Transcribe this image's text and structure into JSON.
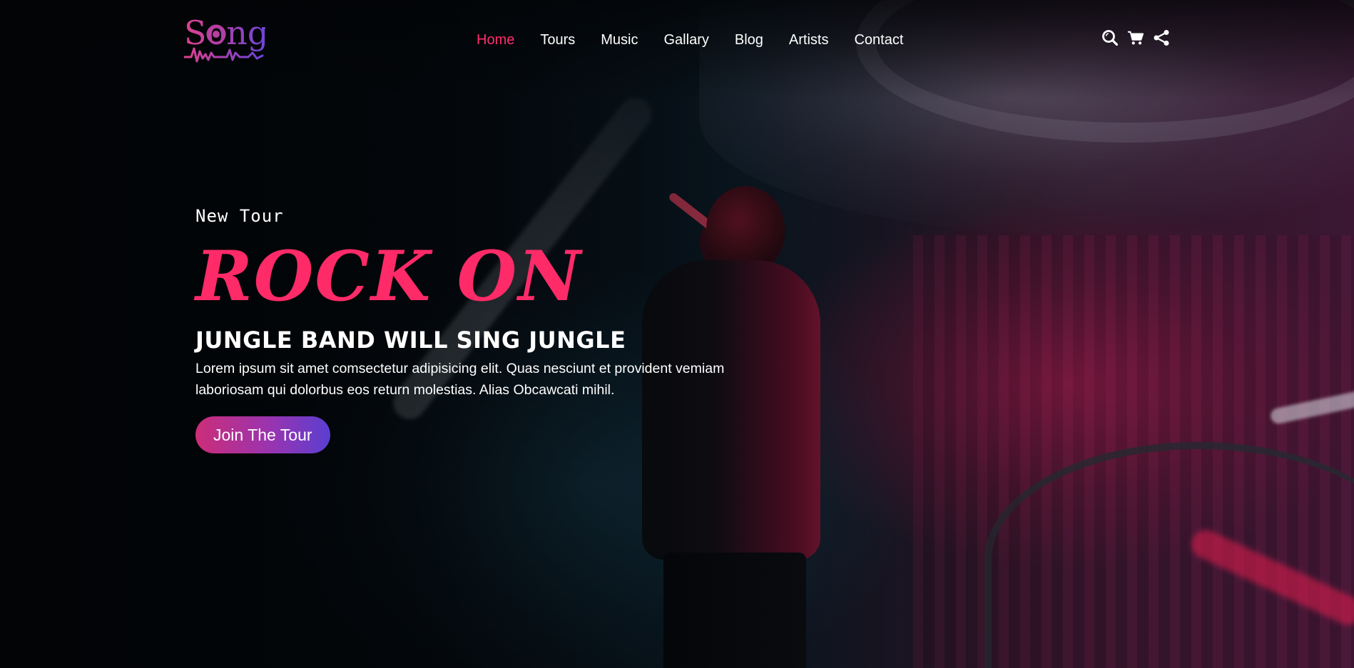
{
  "header": {
    "logo_text": "Song",
    "nav": [
      {
        "label": "Home",
        "active": true
      },
      {
        "label": "Tours",
        "active": false
      },
      {
        "label": "Music",
        "active": false
      },
      {
        "label": "Gallary",
        "active": false
      },
      {
        "label": "Blog",
        "active": false
      },
      {
        "label": "Artists",
        "active": false
      },
      {
        "label": "Contact",
        "active": false
      }
    ],
    "icons": [
      "search-icon",
      "cart-icon",
      "share-icon"
    ]
  },
  "hero": {
    "eyebrow": "New Tour",
    "title": "ROCK ON",
    "subtitle": "JUNGLE BAND WILL SING JUNGLE",
    "description_line1": "Lorem ipsum sit amet comsectetur adipisicing elit. Quas nesciunt et provident vemiam",
    "description_line2": "laboriosam qui dolorbus eos return molestias. Alias Obcawcati mihil.",
    "cta_label": "Join The Tour"
  },
  "colors": {
    "accent": "#ff2a68",
    "nav_active": "#ff2d6d",
    "cta_gradient_start": "#cc2d78",
    "cta_gradient_end": "#5a3fd0",
    "logo": "#b84aa8"
  }
}
